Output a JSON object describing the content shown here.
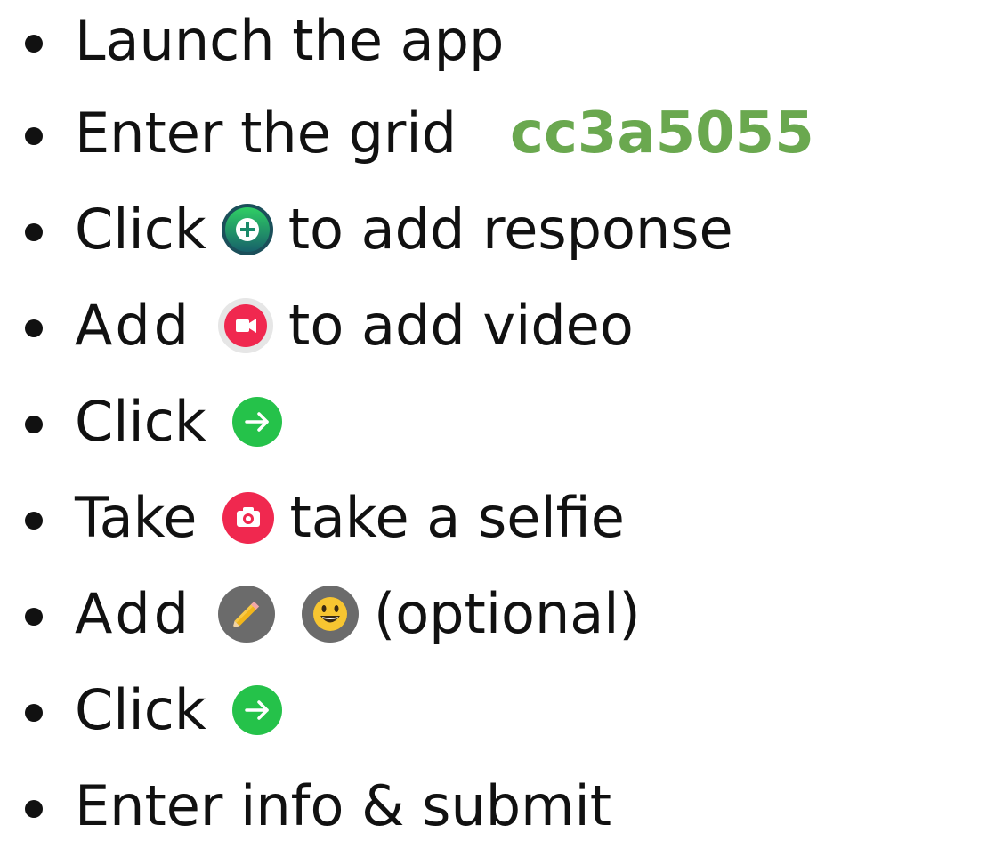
{
  "steps": [
    {
      "text": "Launch the app"
    },
    {
      "pre": "Enter the grid",
      "code": "cc3a5055"
    },
    {
      "pre": "Click",
      "post": "to add response",
      "icon": "plus-circle-icon"
    },
    {
      "pre": "Add",
      "post": "to add video",
      "icon": "video-record-icon"
    },
    {
      "pre": "Click",
      "icon": "next-arrow-icon"
    },
    {
      "pre": "Take",
      "post": "take a selfie",
      "icon": "camera-icon"
    },
    {
      "pre": "Add",
      "post": "(optional)",
      "icons": [
        "pencil-icon",
        "emoji-icon"
      ]
    },
    {
      "pre": "Click",
      "icon": "next-arrow-icon"
    },
    {
      "text": "Enter info & submit"
    }
  ],
  "colors": {
    "code_green": "#6aa84f",
    "plus_teal": "#1a8a6a",
    "record_red": "#f0284f",
    "arrow_green": "#25c24a",
    "grey_button": "#6b6b6b"
  }
}
